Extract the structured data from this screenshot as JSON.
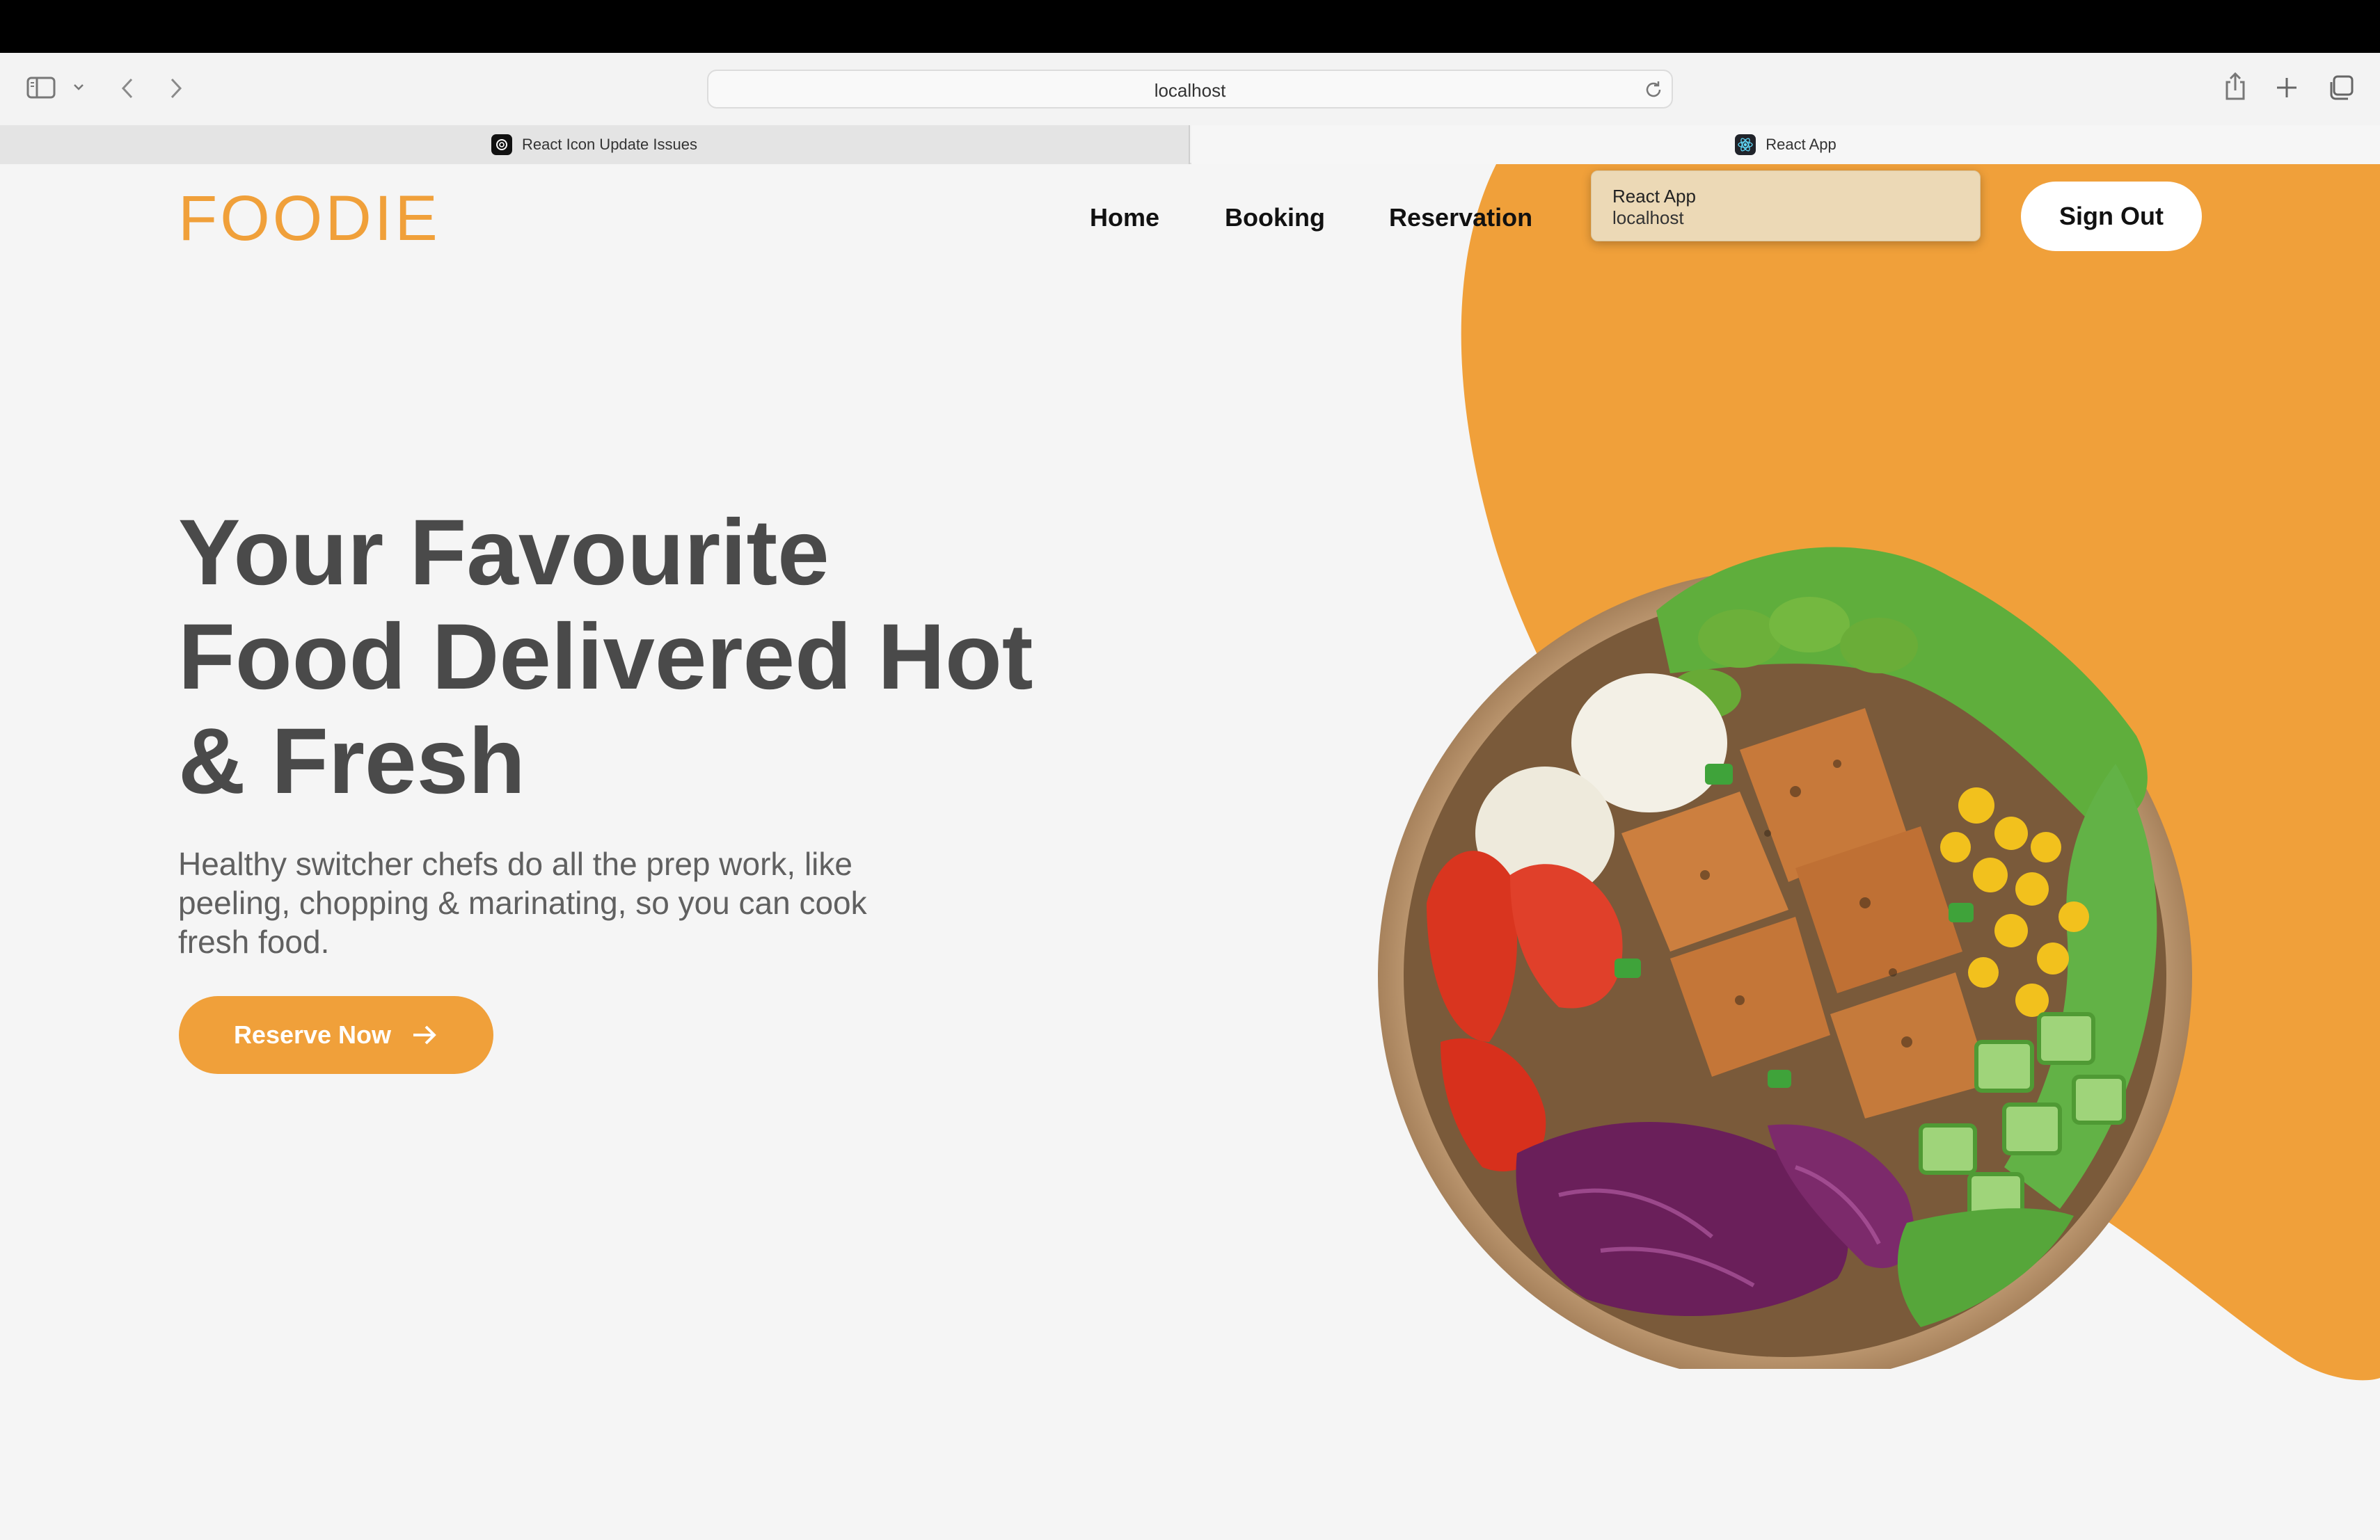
{
  "browser": {
    "url": "localhost",
    "tabs": [
      {
        "title": "React Icon Update Issues"
      },
      {
        "title": "React App"
      }
    ],
    "icons": [
      "sidebar-icon",
      "chevron-down-icon",
      "back-icon",
      "forward-icon",
      "reload-icon",
      "share-icon",
      "new-tab-icon",
      "tab-overview-icon",
      "close-icon"
    ]
  },
  "tooltip": {
    "title": "React App",
    "subtitle": "localhost"
  },
  "site": {
    "logo": "FOODIE",
    "nav": [
      "Home",
      "Booking",
      "Reservation"
    ],
    "sign_out": "Sign Out",
    "hero": {
      "headline_lines": [
        "Your Favourite",
        "Food Delivered Hot",
        "& Fresh"
      ],
      "subtext": "Healthy switcher chefs do all the prep work, like peeling, chopping & marinating, so you can cook fresh food.",
      "cta": "Reserve Now"
    }
  },
  "colors": {
    "accent": "#f0a03a",
    "background": "#f5f5f5",
    "headline": "#4a4a4a"
  }
}
